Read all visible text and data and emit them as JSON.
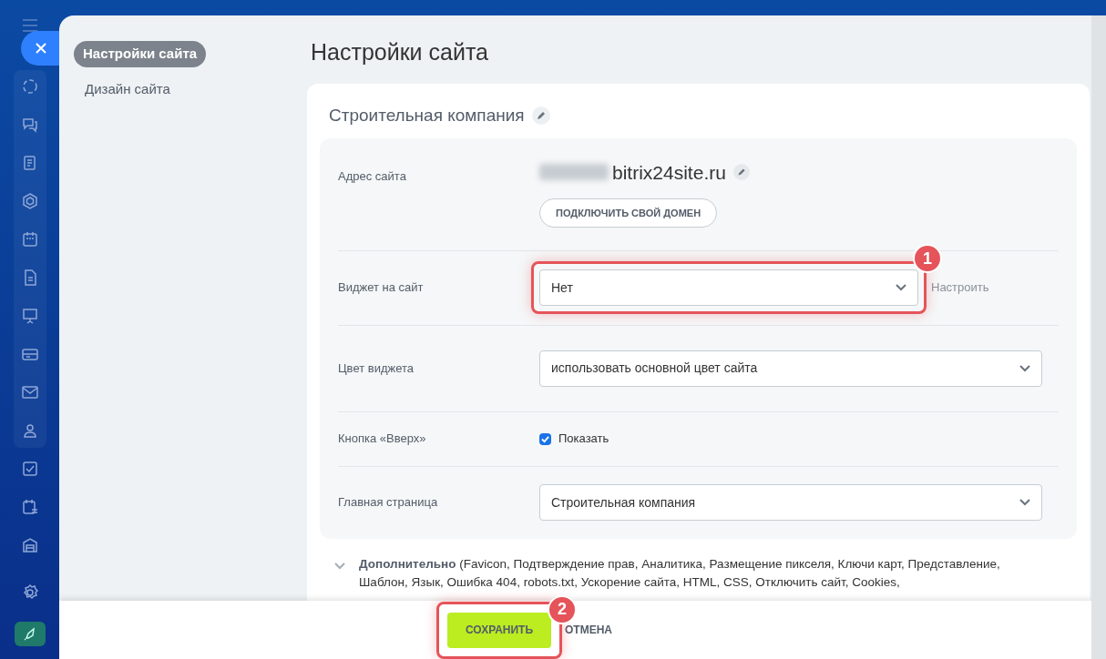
{
  "nav": [
    {
      "label": "Настройки сайта",
      "selected": true
    },
    {
      "label": "Дизайн сайта",
      "selected": false
    }
  ],
  "page_title": "Настройки сайта",
  "site_name": "Строительная компания",
  "fields": [
    {
      "kind": "address",
      "label": "Адрес сайта",
      "domain": "bitrix24site.ru",
      "button": "ПОДКЛЮЧИТЬ СВОЙ ДОМЕН"
    },
    {
      "kind": "select",
      "label": "Виджет на сайт",
      "value": "Нет",
      "link": "Настроить",
      "callout": "1"
    },
    {
      "kind": "select",
      "label": "Цвет виджета",
      "value": "использовать основной цвет сайта"
    },
    {
      "kind": "checkbox",
      "label": "Кнопка «Вверх»",
      "option": "Показать",
      "checked": true
    },
    {
      "kind": "select",
      "label": "Главная страница",
      "value": "Строительная компания"
    }
  ],
  "additional": {
    "label": "Дополнительно",
    "details": "(Favicon, Подтверждение прав, Аналитика, Размещение пикселя, Ключи карт, Представление, Шаблон, Язык, Ошибка 404, robots.txt, Ускорение сайта, HTML, CSS, Отключить сайт, Cookies,"
  },
  "footer": {
    "save": "СОХРАНИТЬ",
    "save_callout": "2",
    "cancel": "ОТМЕНА"
  }
}
